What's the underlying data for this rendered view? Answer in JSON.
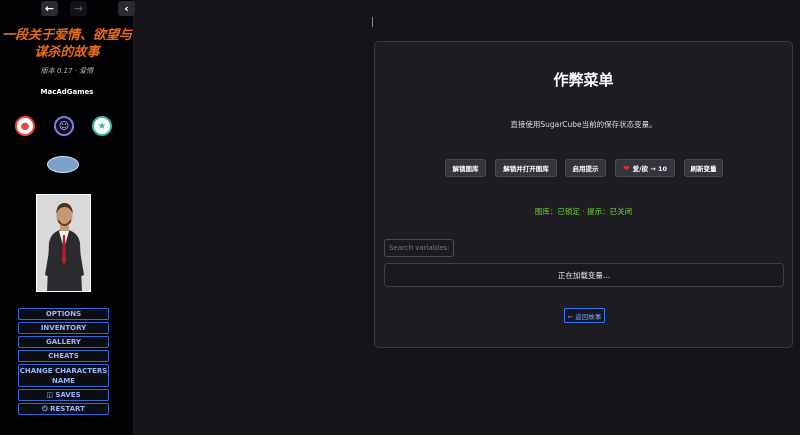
{
  "nav": {
    "back_icon": "arrow-left",
    "forward_icon": "arrow-right",
    "collapse_icon": "chevron-left"
  },
  "sidebar": {
    "story_title": "一段关于爱情、欲望与谋杀的故事",
    "story_subtitle": "版本 0.17 · 爱情",
    "author": "MacAdGames",
    "social_icons": [
      "patreon-icon",
      "discord-icon",
      "subscribe-icon"
    ],
    "menu": [
      {
        "label": "OPTIONS"
      },
      {
        "label": "INVENTORY"
      },
      {
        "label": "GALLERY"
      },
      {
        "label": "CHEATS"
      },
      {
        "label": "CHANGE CHARACTERS NAME"
      },
      {
        "label": "SAVES",
        "icon": "floppy-icon"
      },
      {
        "label": "RESTART",
        "icon": "power-icon"
      }
    ]
  },
  "cheat_menu": {
    "title": "作弊菜单",
    "description": "直接使用SugarCube当前的保存状态变量。",
    "buttons": [
      {
        "label": "解锁图库"
      },
      {
        "label": "解锁并打开图库"
      },
      {
        "label": "启用提示"
      },
      {
        "label": "爱/欲 → 10",
        "icon": "heart-icon"
      },
      {
        "label": "刷新变量"
      }
    ],
    "status": "图库：已锁定 · 提示：已关闭",
    "search_placeholder": "Search variables:",
    "loading_text": "正在加载变量...",
    "return_label": "← 返回故事"
  },
  "colors": {
    "title_orange": "#e56a1a",
    "status_green": "#6cd336",
    "menu_blue": "#2e6bdb",
    "heart_red": "#e0283a"
  }
}
